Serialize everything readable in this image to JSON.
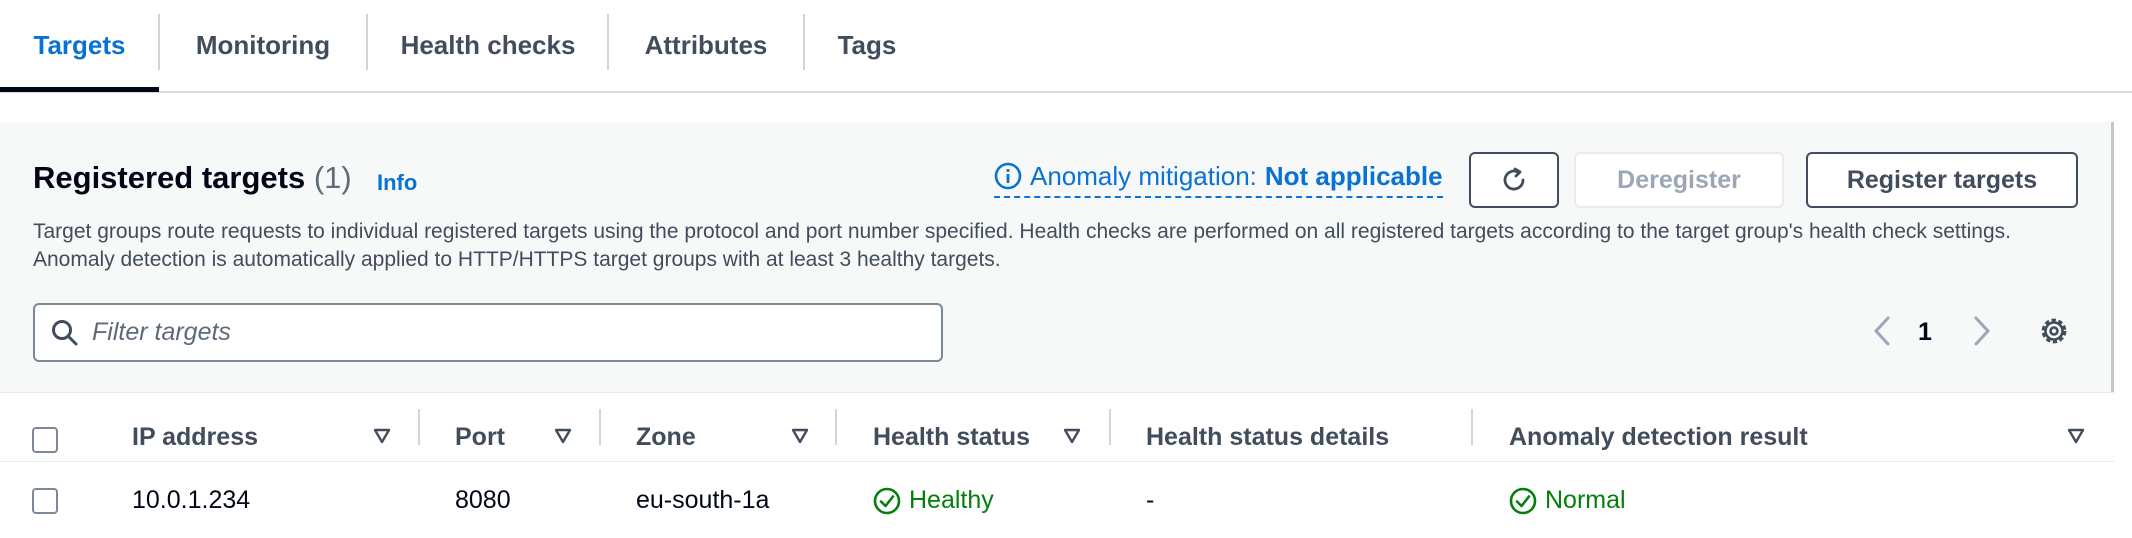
{
  "tabs": [
    {
      "label": "Targets",
      "active": true
    },
    {
      "label": "Monitoring",
      "active": false
    },
    {
      "label": "Health checks",
      "active": false
    },
    {
      "label": "Attributes",
      "active": false
    },
    {
      "label": "Tags",
      "active": false
    }
  ],
  "panel": {
    "title": "Registered targets",
    "count": "(1)",
    "info_link": "Info",
    "anomaly_label": "Anomaly mitigation:",
    "anomaly_value": "Not applicable",
    "refresh_icon": "refresh-icon",
    "deregister_label": "Deregister",
    "register_label": "Register targets",
    "description": "Target groups route requests to individual registered targets using the protocol and port number specified. Health checks are performed on all registered targets according to the target group's health check settings. Anomaly detection is automatically applied to HTTP/HTTPS target groups with at least 3 healthy targets.",
    "filter_placeholder": "Filter targets",
    "page": "1"
  },
  "table": {
    "columns": [
      "IP address",
      "Port",
      "Zone",
      "Health status",
      "Health status details",
      "Anomaly detection result"
    ],
    "rows": [
      {
        "ip": "10.0.1.234",
        "port": "8080",
        "zone": "eu-south-1a",
        "health_status": "Healthy",
        "health_details": "-",
        "anomaly_result": "Normal"
      }
    ]
  },
  "colors": {
    "accent": "#0972d3",
    "success": "#037f0c",
    "text": "#000716",
    "muted": "#414d5c"
  }
}
